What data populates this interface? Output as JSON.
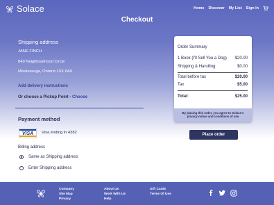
{
  "header": {
    "brand": "Solace",
    "nav": [
      "Home",
      "Discover",
      "My List",
      "Sign In"
    ]
  },
  "page_title": "Checkout",
  "shipping": {
    "title": "Shipping address",
    "name": "JANE FINCH",
    "street": "840 Neighbourhood Circle",
    "city": "Mississauga, Ontario L5X 6A0",
    "add_delivery": "Add delivery instructions",
    "pickup_text": "Or choose a Pickup Point  -",
    "choose": "Choose"
  },
  "payment": {
    "title": "Payment method",
    "card_brand": "VISA",
    "card_ending": "Visa ending in 4382"
  },
  "billing": {
    "title": "Billing address",
    "options": [
      {
        "label": "Same as Shipping address",
        "checked": true
      },
      {
        "label": "Enter Shipping address",
        "checked": false
      }
    ]
  },
  "summary": {
    "title": "Order Summary",
    "items": [
      {
        "label": "1 Book (I'll Sell You a Dog)",
        "value": "$20.00"
      },
      {
        "label": "Shipping & Handling",
        "value": "$0.00"
      }
    ],
    "before_tax": {
      "label": "Total before tax",
      "value": "$20.00"
    },
    "tax": {
      "label": "Tax",
      "value": "$5.00"
    },
    "total": {
      "label": "Total:",
      "value": "$25.00"
    },
    "notice": "By placing this order, you agree to Solace's privacy notice and conditions of use"
  },
  "place_order": "Place order",
  "footer": {
    "col1": [
      "Company",
      "Site Map",
      "Privacy"
    ],
    "col2": [
      "About Us",
      "Work With Us",
      "Help"
    ],
    "col3": [
      "Gift Cards",
      "Terms Of Use"
    ],
    "social": [
      "facebook-icon",
      "twitter-icon",
      "instagram-icon"
    ]
  },
  "colors": {
    "primary": "#5b67be",
    "dark": "#2f3561",
    "footer": "#5561b5"
  }
}
